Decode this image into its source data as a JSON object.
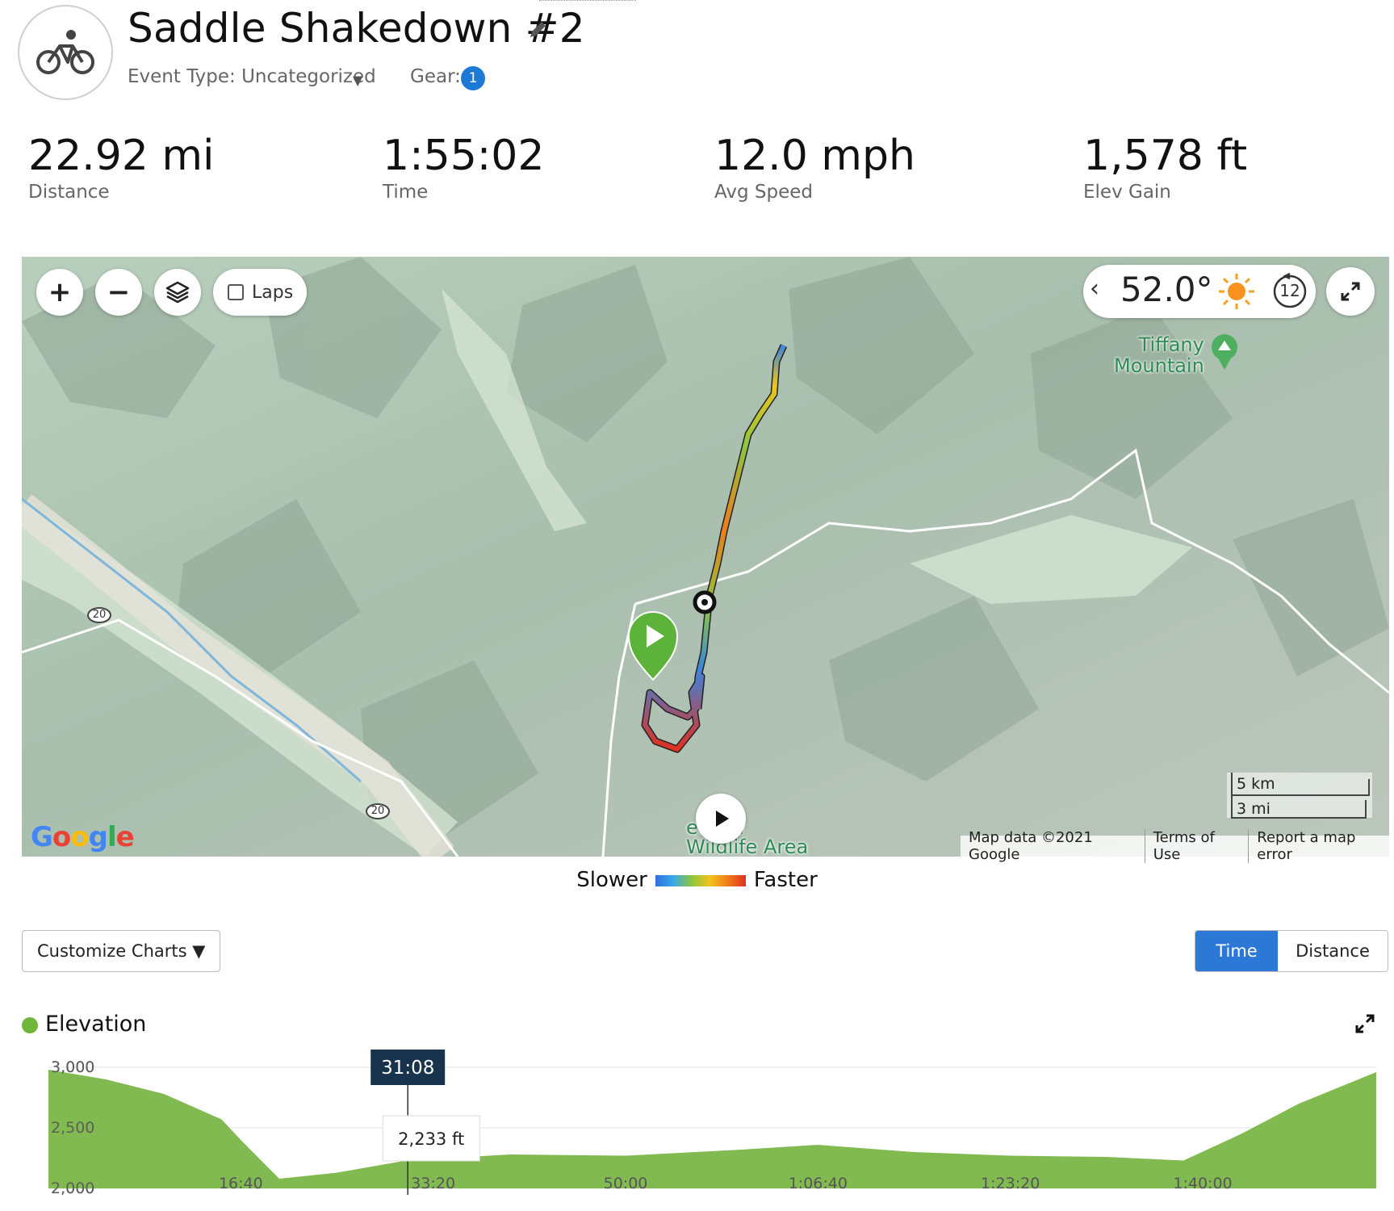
{
  "activity": {
    "title": "Saddle Shakedown #2",
    "icon": "bicycle-icon",
    "event_type_label": "Event Type: Uncategorized",
    "event_caret": "▼",
    "gear_label": "Gear:",
    "gear_count": "1"
  },
  "stats": [
    {
      "value": "22.92 mi",
      "label": "Distance"
    },
    {
      "value": "1:55:02",
      "label": "Time"
    },
    {
      "value": "12.0 mph",
      "label": "Avg Speed"
    },
    {
      "value": "1,578 ft",
      "label": "Elev Gain"
    }
  ],
  "map": {
    "controls": {
      "zoom_in": "+",
      "zoom_out": "−",
      "laps_label": "Laps",
      "laps_checked": false
    },
    "weather": {
      "temperature": "52.0°",
      "hour": "12",
      "icon": "sun-icon"
    },
    "poi_line1": "Tiffany",
    "poi_line2": "Mountain",
    "road_number": "20",
    "area_line1": "ethow",
    "area_line2": "Wildlife Area",
    "scale_km": "5 km",
    "scale_mi": "3 mi",
    "attribution": "Map data ©2021 Google",
    "terms": "Terms of Use",
    "report": "Report a map error",
    "logo": "Google"
  },
  "legend": {
    "slower": "Slower",
    "faster": "Faster"
  },
  "charts_toolbar": {
    "customize_label": "Customize Charts ▼",
    "time_label": "Time",
    "distance_label": "Distance",
    "active": "Time"
  },
  "elevation": {
    "title": "Elevation",
    "color": "#7ab648",
    "cursor_time": "31:08",
    "cursor_value": "2,233 ft"
  },
  "chart_data": {
    "type": "area",
    "title": "Elevation",
    "xlabel": "",
    "ylabel": "",
    "y_ticks": [
      "3,000",
      "2,500",
      "2,000"
    ],
    "x_ticks": [
      "16:40",
      "33:20",
      "50:00",
      "1:06:40",
      "1:23:20",
      "1:40:00"
    ],
    "ylim": [
      2000,
      3000
    ],
    "xlim_seconds": [
      0,
      6902
    ],
    "series": [
      {
        "x_seconds": [
          0,
          300,
          600,
          900,
          1000,
          1200,
          1500,
          1868,
          2400,
          3000,
          3600,
          4000,
          4500,
          5000,
          5500,
          5900,
          6200,
          6500,
          6902
        ],
        "values": [
          2980,
          2900,
          2780,
          2570,
          2400,
          2080,
          2130,
          2233,
          2280,
          2270,
          2320,
          2360,
          2300,
          2270,
          2260,
          2230,
          2450,
          2700,
          2960
        ]
      }
    ]
  }
}
